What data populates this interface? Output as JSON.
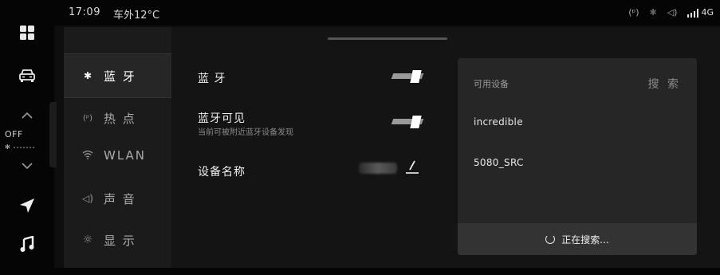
{
  "status": {
    "time": "17:09",
    "outside_temp": "车外12°C",
    "network": "4G"
  },
  "dock": {
    "climate_state": "OFF",
    "items": [
      "apps-icon",
      "car-icon",
      "navigation-icon",
      "music-icon"
    ]
  },
  "nav": {
    "items": [
      {
        "label": "蓝 牙",
        "icon": "bluetooth-icon",
        "active": true
      },
      {
        "label": "热 点",
        "icon": "hotspot-icon",
        "active": false
      },
      {
        "label": "WLAN",
        "icon": "wifi-icon",
        "active": false
      },
      {
        "label": "声 音",
        "icon": "speaker-icon",
        "active": false
      },
      {
        "label": "显 示",
        "icon": "brightness-icon",
        "active": false
      }
    ]
  },
  "bluetooth": {
    "toggle_label": "蓝 牙",
    "visible_label": "蓝牙可见",
    "visible_sub": "当前可被附近蓝牙设备发现",
    "device_name_label": "设备名称",
    "bluetooth_on": true,
    "visible_on": true
  },
  "devices": {
    "header": "可用设备",
    "search_label": "搜 索",
    "items": [
      "incredible",
      "5080_SRC"
    ],
    "status": "正在搜索..."
  },
  "colors": {
    "background": "#0e0e0e",
    "panel": "#262626",
    "accent": "#ffffff"
  }
}
